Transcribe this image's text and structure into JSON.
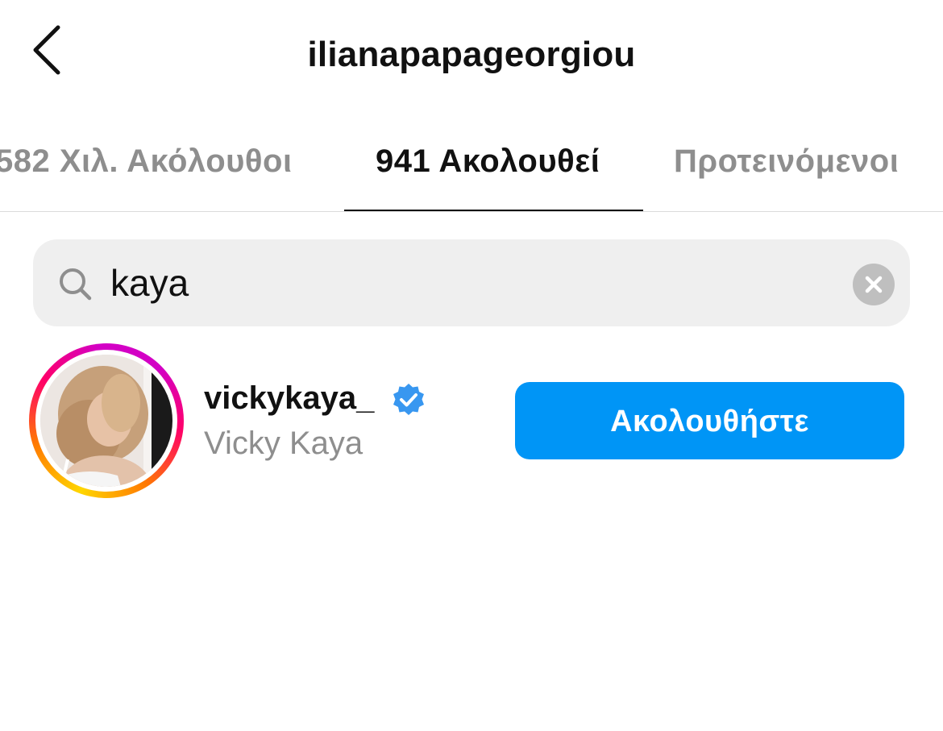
{
  "header": {
    "title": "ilianapapageorgiou"
  },
  "tabs": [
    {
      "label": "582 Χιλ. Ακόλουθοι",
      "active": false
    },
    {
      "label": "941 Ακολουθεί",
      "active": true
    },
    {
      "label": "Προτεινόμενοι",
      "active": false
    }
  ],
  "search": {
    "value": "kaya"
  },
  "results": [
    {
      "username": "vickykaya_",
      "full_name": "Vicky Kaya",
      "verified": true,
      "button_label": "Ακολουθήστε"
    }
  ],
  "colors": {
    "accent": "#0095f6",
    "verified": "#3897f0",
    "muted_text": "#8e8e8e"
  },
  "icons": {
    "back": "chevron-left-icon",
    "search": "search-icon",
    "clear": "clear-circle-icon",
    "verified": "verified-badge-icon"
  }
}
